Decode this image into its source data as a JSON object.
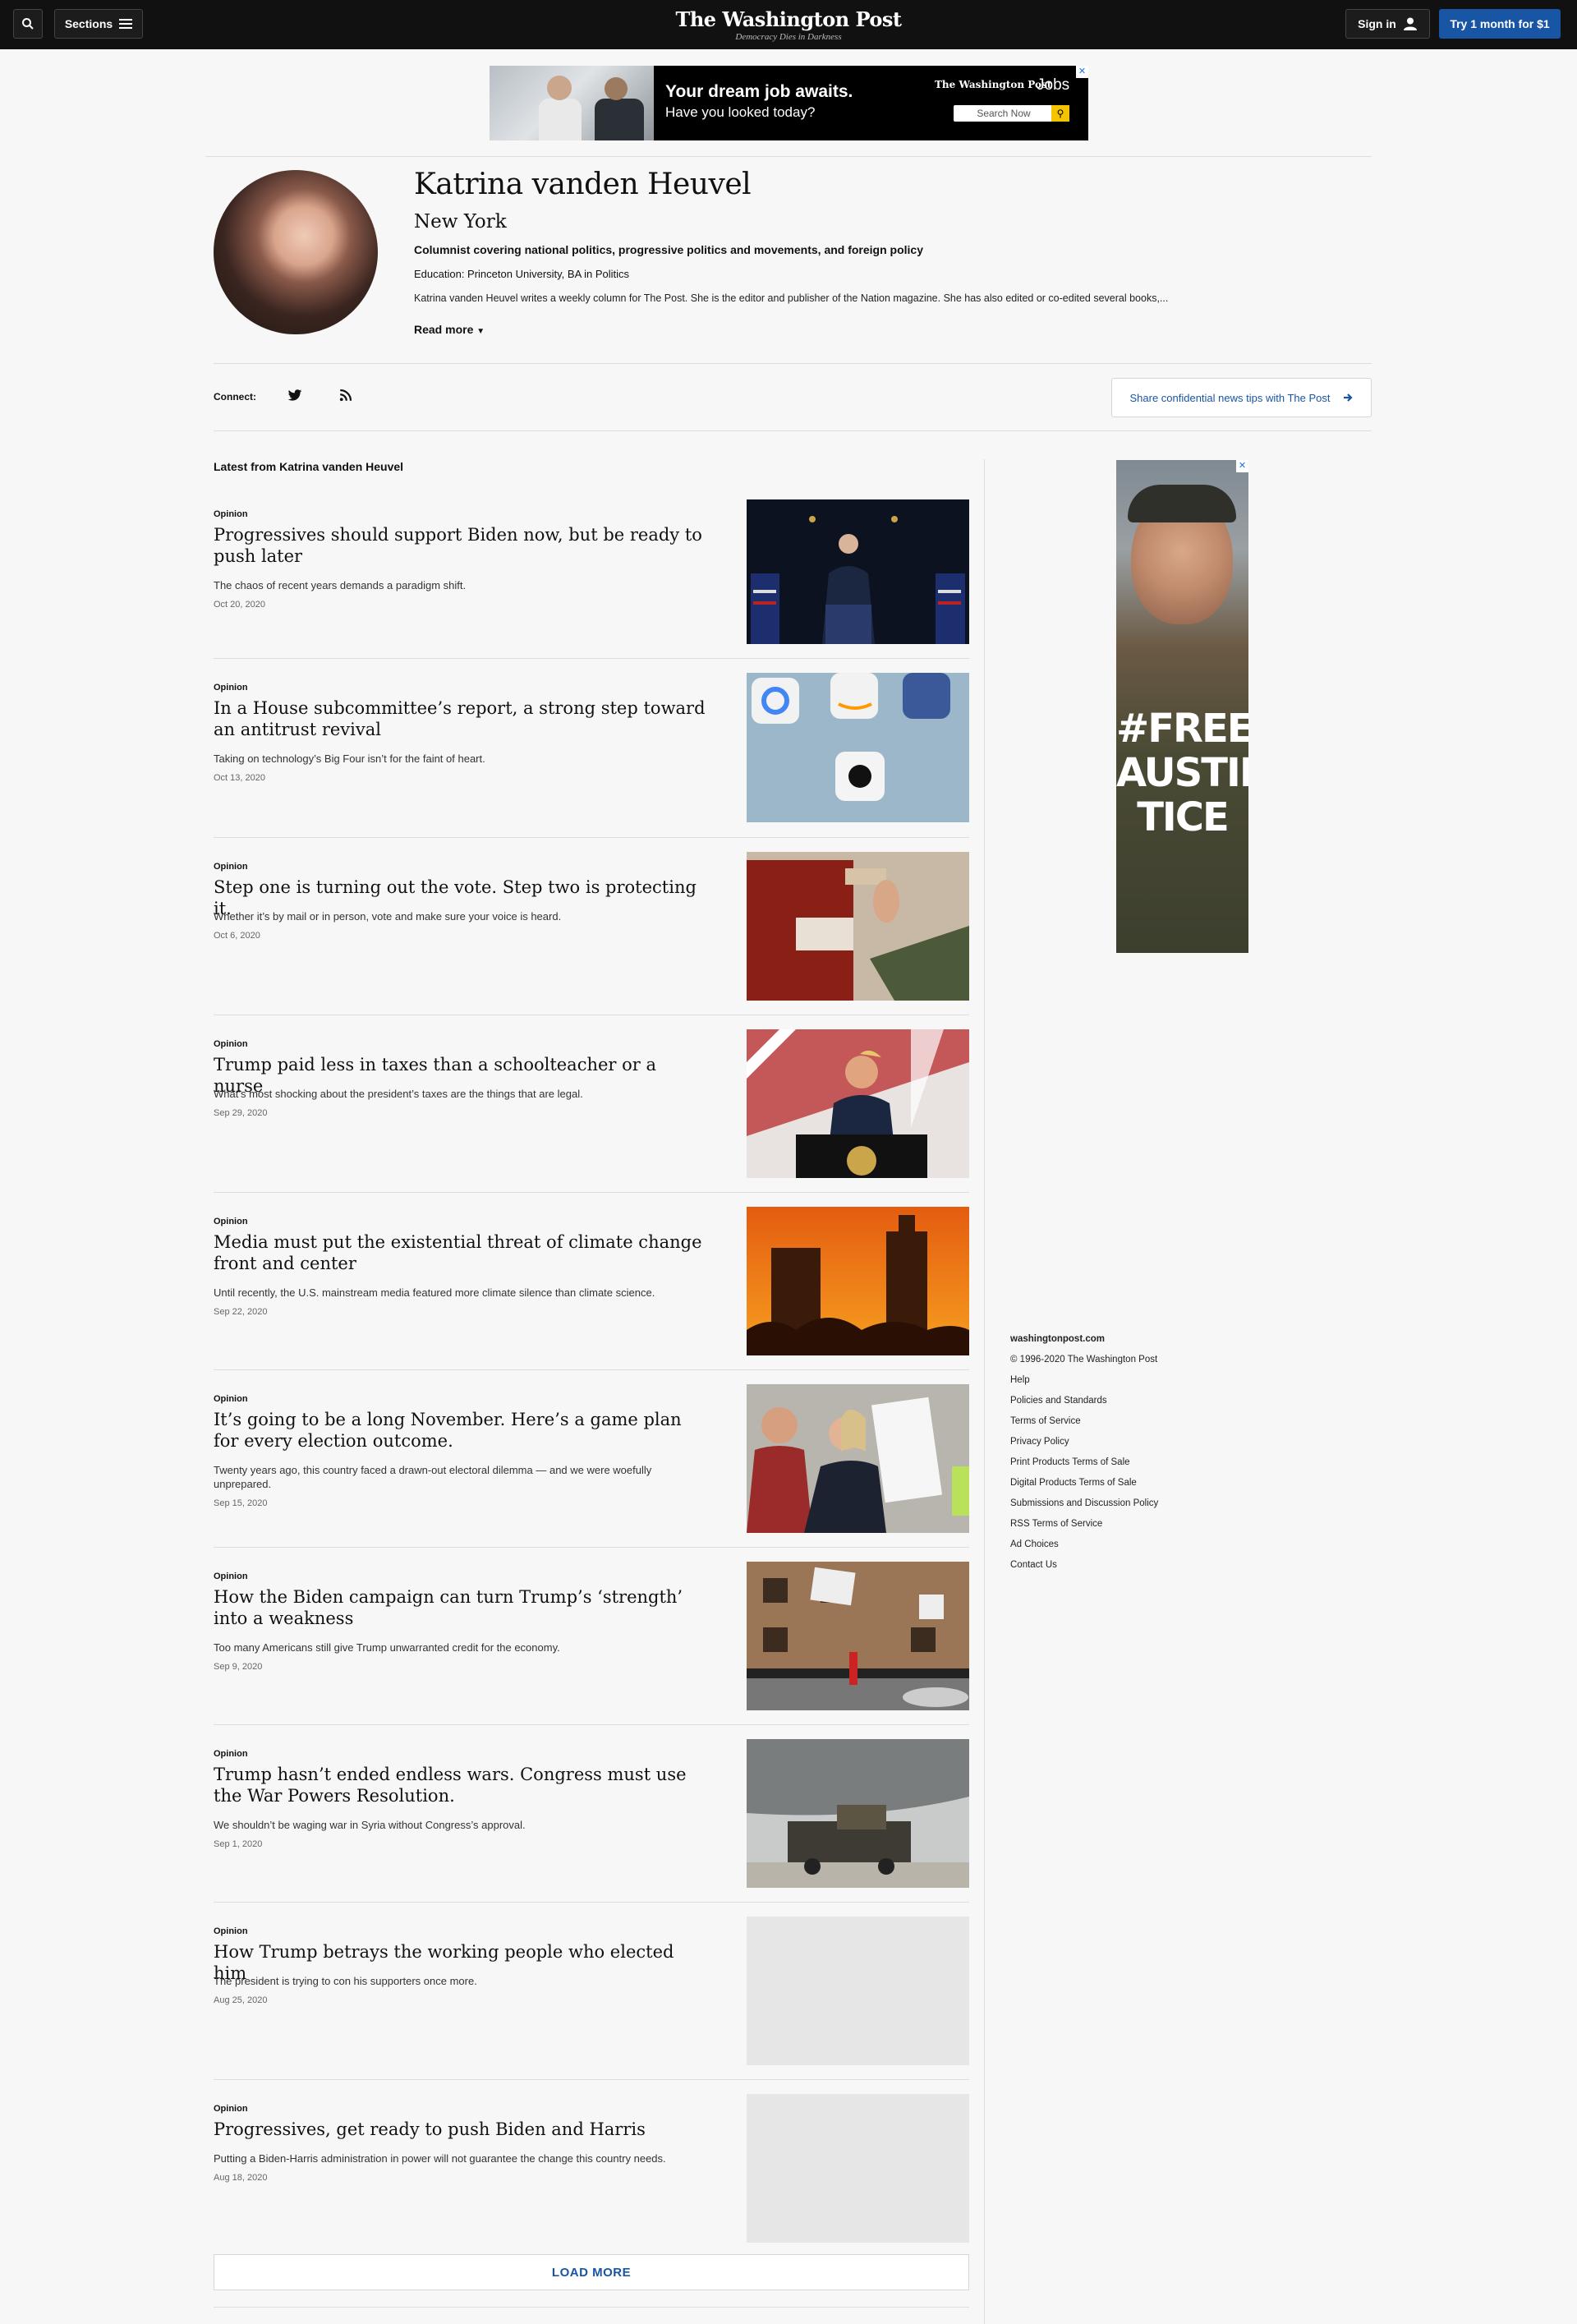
{
  "header": {
    "sections_label": "Sections",
    "logo": "The Washington Post",
    "tagline": "Democracy Dies in Darkness",
    "sign_in": "Sign in",
    "subscribe": "Try 1 month for $1"
  },
  "top_ad": {
    "headline": "Your dream job awaits.",
    "subline": "Have you looked today?",
    "brand": "The Washington Post",
    "brand_suffix": "Jobs",
    "search_button": "Search Now"
  },
  "author": {
    "name": "Katrina vanden Heuvel",
    "city": "New York",
    "role": "Columnist covering national politics, progressive politics and movements, and foreign policy",
    "education": "Education: Princeton University, BA in Politics",
    "bio": "Katrina vanden Heuvel writes a weekly column for The Post. She is the editor and publisher of the Nation magazine. She has also edited or co-edited several books,...",
    "read_more": "Read more",
    "connect_label": "Connect:",
    "tips_button": "Share confidential news tips with The Post"
  },
  "latest": {
    "title": "Latest from Katrina vanden Heuvel",
    "articles": [
      {
        "label": "Opinion",
        "headline": "Progressives should support Biden now, but be ready to push later",
        "blurb": "The chaos of recent years demands a paradigm shift.",
        "date": "Oct 20, 2020"
      },
      {
        "label": "Opinion",
        "headline": "In a House subcommittee’s report, a strong step toward an antitrust revival",
        "blurb": "Taking on technology’s Big Four isn’t for the faint of heart.",
        "date": "Oct 13, 2020"
      },
      {
        "label": "Opinion",
        "headline": "Step one is turning out the vote. Step two is protecting it.",
        "blurb": "Whether it’s by mail or in person, vote and make sure your voice is heard.",
        "date": "Oct 6, 2020"
      },
      {
        "label": "Opinion",
        "headline": "Trump paid less in taxes than a schoolteacher or a nurse",
        "blurb": "What’s most shocking about the president’s taxes are the things that are legal.",
        "date": "Sep 29, 2020"
      },
      {
        "label": "Opinion",
        "headline": "Media must put the existential threat of climate change front and center",
        "blurb": "Until recently, the U.S. mainstream media featured more climate silence than climate science.",
        "date": "Sep 22, 2020"
      },
      {
        "label": "Opinion",
        "headline": "It’s going to be a long November. Here’s a game plan for every election outcome.",
        "blurb": "Twenty years ago, this country faced a drawn-out electoral dilemma — and we were woefully unprepared.",
        "date": "Sep 15, 2020"
      },
      {
        "label": "Opinion",
        "headline": "How the Biden campaign can turn Trump’s ‘strength’ into a weakness",
        "blurb": "Too many Americans still give Trump unwarranted credit for the economy.",
        "date": "Sep 9, 2020"
      },
      {
        "label": "Opinion",
        "headline": "Trump hasn’t ended endless wars. Congress must use the War Powers Resolution.",
        "blurb": "We shouldn’t be waging war in Syria without Congress’s approval.",
        "date": "Sep 1, 2020"
      },
      {
        "label": "Opinion",
        "headline": "How Trump betrays the working people who elected him",
        "blurb": "The president is trying to con his supporters once more.",
        "date": "Aug 25, 2020"
      },
      {
        "label": "Opinion",
        "headline": "Progressives, get ready to push Biden and Harris",
        "blurb": "Putting a Biden-Harris administration in power will not guarantee the change this country needs.",
        "date": "Aug 18, 2020"
      }
    ],
    "load_more": "LOAD MORE"
  },
  "side_ad": {
    "text": "#FREE AUSTIN TICE"
  },
  "footer": {
    "site": "washingtonpost.com",
    "copyright": "© 1996-2020 The Washington Post",
    "links": [
      "Help",
      "Policies and Standards",
      "Terms of Service",
      "Privacy Policy",
      "Print Products Terms of Sale",
      "Digital Products Terms of Sale",
      "Submissions and Discussion Policy",
      "RSS Terms of Service",
      "Ad Choices",
      "Contact Us"
    ]
  },
  "colors": {
    "nav_bg": "#111111",
    "accent_blue": "#1955a5",
    "page_bg": "#f7f7f7"
  }
}
